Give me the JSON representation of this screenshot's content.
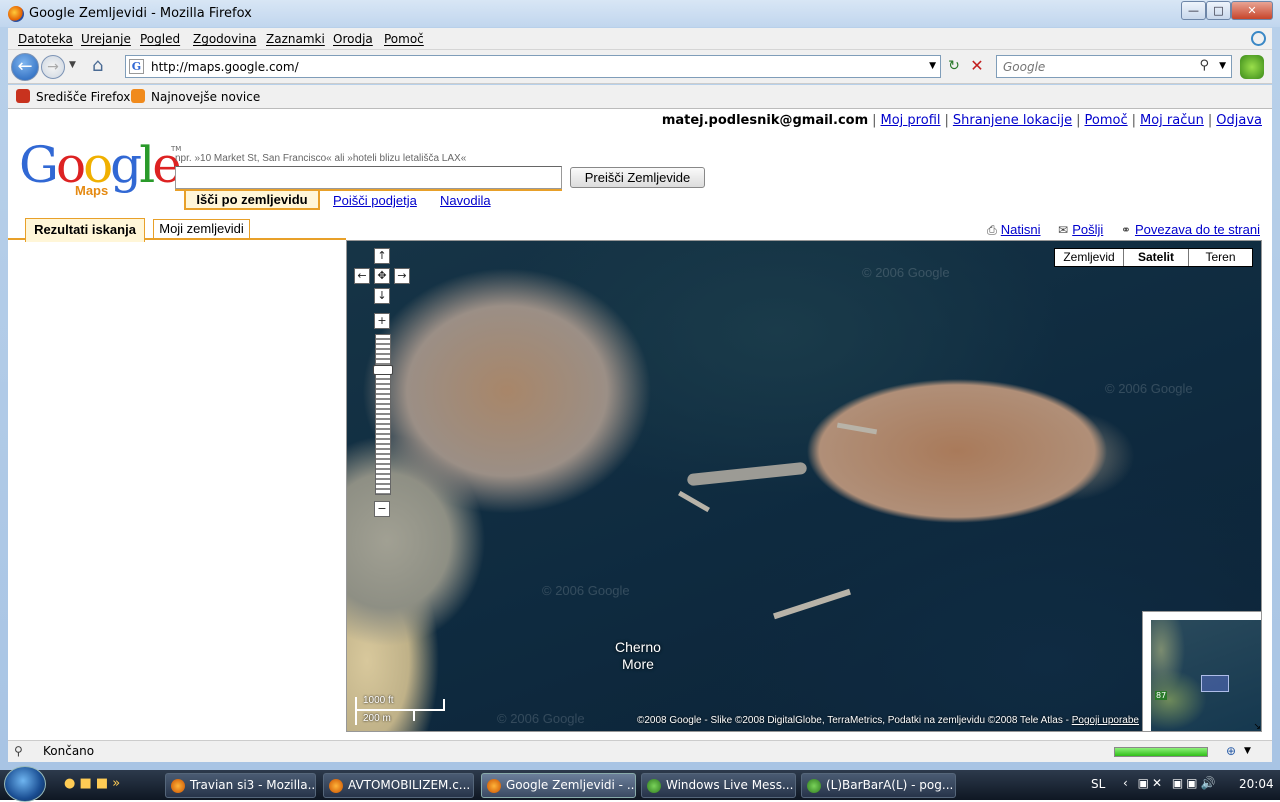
{
  "window": {
    "title": "Google Zemljevidi - Mozilla Firefox"
  },
  "menu": [
    "Datoteka",
    "Urejanje",
    "Pogled",
    "Zgodovina",
    "Zaznamki",
    "Orodja",
    "Pomoč"
  ],
  "url": "http://maps.google.com/",
  "search_placeholder": "Google",
  "bookmarks": [
    "Središče Firefox",
    "Najnovejše novice"
  ],
  "user": {
    "email": "matej.podlesnik@gmail.com",
    "links": [
      "Moj profil",
      "Shranjene lokacije",
      "Pomoč",
      "Moj račun",
      "Odjava"
    ]
  },
  "logo": {
    "word": "Google",
    "sub": "Maps"
  },
  "search": {
    "hint": "npr. »10 Market St, San Francisco« ali »hoteli blizu letališča LAX«",
    "button": "Preišči Zemljevide",
    "tabs": [
      "Išči po zemljevidu",
      "Poišči podjetja",
      "Navodila"
    ]
  },
  "left_tabs": [
    "Rezultati iskanja",
    "Moji zemljevidi"
  ],
  "map_links": [
    "Natisni",
    "Pošlji",
    "Povezava do te strani"
  ],
  "map_types": [
    "Zemljevid",
    "Satelit",
    "Teren"
  ],
  "map_types_selected": "Satelit",
  "sea_label": [
    "Cherno",
    "More"
  ],
  "scale": {
    "ft": "1000 ft",
    "m": "200 m"
  },
  "copyright": "©2008 Google - Slike ©2008 DigitalGlobe, TerraMetrics, Podatki na zemljevidu ©2008 Tele Atlas - ",
  "terms": "Pogoji uporabe",
  "overview_road": "87",
  "status": "Končano",
  "taskbar": {
    "items": [
      "Travian si3 - Mozilla...",
      "AVTOMOBILIZEM.c...",
      "Google Zemljevidi - ...",
      "Windows Live Mess...",
      "(L)BarBarA(L) - pog..."
    ],
    "lang": "SL",
    "clock": "20:04"
  }
}
